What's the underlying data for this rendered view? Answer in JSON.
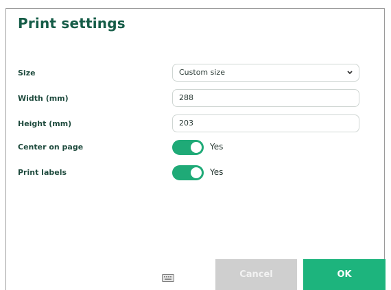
{
  "dialog": {
    "title": "Print settings"
  },
  "fields": {
    "size": {
      "label": "Size",
      "value": "Custom size"
    },
    "width": {
      "label": "Width (mm)",
      "value": "288"
    },
    "height": {
      "label": "Height (mm)",
      "value": "203"
    },
    "center_on_page": {
      "label": "Center on page",
      "state": "Yes"
    },
    "print_labels": {
      "label": "Print labels",
      "state": "Yes"
    }
  },
  "buttons": {
    "cancel_label": "Cancel",
    "ok_label": "OK"
  },
  "icons": {
    "dropdown": "chevron-down-icon",
    "keyboard": "keyboard-icon"
  },
  "colors": {
    "title": "#155c47",
    "toggle_on": "#1faa77",
    "ok_button": "#1db47d",
    "cancel_button": "#cfcfcf"
  }
}
